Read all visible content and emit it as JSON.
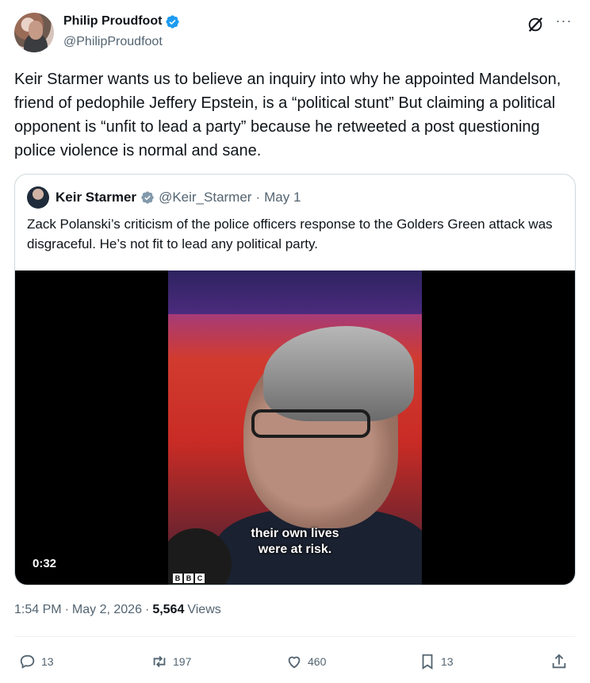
{
  "author": {
    "display_name": "Philip Proudfoot",
    "handle": "@PhilipProudfoot"
  },
  "icons": {
    "verified": "verified-badge-icon",
    "grok": "grok-icon",
    "more": "more-icon",
    "reply": "reply-icon",
    "retweet": "retweet-icon",
    "like": "like-icon",
    "bookmark": "bookmark-icon",
    "share": "share-icon"
  },
  "colors": {
    "verified": "#1d9bf0",
    "text": "#0f1419",
    "muted": "#536471"
  },
  "tweet": {
    "text": "Keir Starmer wants us to believe an inquiry into why he appointed Mandelson, friend of pedophile Jeffery Epstein, is a “political stunt” But claiming a political opponent is “unfit to lead a party” because he retweeted a post questioning police violence is normal and sane."
  },
  "quote": {
    "display_name": "Keir Starmer",
    "handle": "@Keir_Starmer",
    "separator": "·",
    "date": "May 1",
    "text": "Zack Polanski’s criticism of the police officers response to the Golders Green attack was disgraceful.  He’s not fit to lead any political party.",
    "video": {
      "caption_line1": "their own lives",
      "caption_line2": "were at risk.",
      "duration": "0:32",
      "bbc": [
        "B",
        "B",
        "C"
      ]
    }
  },
  "meta": {
    "time": "1:54 PM",
    "sep": "·",
    "date": "May 2, 2026",
    "sep2": "·",
    "views_count": "5,564",
    "views_label": "Views"
  },
  "actions": {
    "replies": "13",
    "retweets": "197",
    "likes": "460",
    "bookmarks": "13"
  }
}
